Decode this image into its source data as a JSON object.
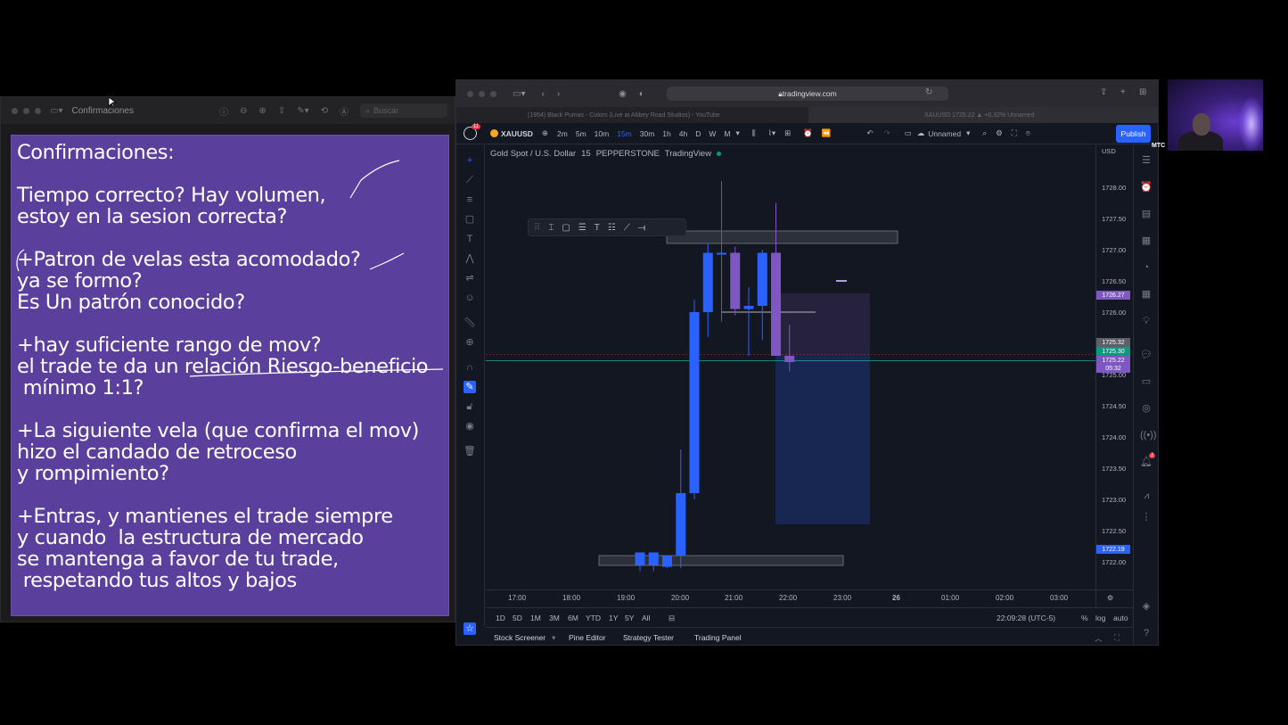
{
  "preview": {
    "title": "Confirmaciones",
    "search_placeholder": "Buscar",
    "slide_lines": [
      "Confirmaciones:",
      "Tiempo correcto? Hay volumen,",
      "estoy en la sesion correcta?",
      "+Patron de velas esta acomodado?",
      "ya se formo?",
      "Es Un patrón conocido?",
      "+hay suficiente rango de mov?",
      "el trade te da un relación Riesgo-beneficio",
      " mínimo 1:1?",
      "+La siguiente vela (que confirma el mov)",
      "hizo el candado de retroceso",
      "y rompimiento?",
      "+Entras, y mantienes el trade siempre",
      "y cuando  la estructura de mercado",
      "se mantenga a favor de tu trade,",
      " respetando tus altos y bajos"
    ]
  },
  "browser": {
    "url": "tradingview.com",
    "tab1": "(1954) Black Pumas - Colors (Live at Abbey Road Studios) - YouTube",
    "tab2": "XAUUSD 1725.22 ▲ +0.32% Unnamed"
  },
  "tv": {
    "notif_count": "11",
    "symbol": "XAUUSD",
    "timeframes": [
      "2m",
      "5m",
      "10m",
      "15m",
      "30m",
      "1h",
      "4h",
      "D",
      "W",
      "M"
    ],
    "active_tf": "15m",
    "layout_name": "Unnamed",
    "publish": "Publish",
    "legend": [
      "Gold Spot / U.S. Dollar",
      "15",
      "PEPPERSTONE",
      "TradingView"
    ],
    "currency": "USD",
    "price_labels": [
      "1728.00",
      "1727.50",
      "1727.00",
      "1726.50",
      "1726.00",
      "1725.00",
      "1724.50",
      "1724.00",
      "1723.50",
      "1723.00",
      "1722.50",
      "1722.00"
    ],
    "tag_purple": "1726.27",
    "tag_gray": "1725.32",
    "tag_green": "1725.30",
    "tag_current": "1725.22",
    "tag_countdown": "05:32",
    "tag_blue": "1722.19",
    "time_labels": [
      "17:00",
      "18:00",
      "19:00",
      "20:00",
      "21:00",
      "22:00",
      "23:00",
      "26",
      "01:00",
      "02:00",
      "03:00"
    ],
    "ranges": [
      "1D",
      "5D",
      "1M",
      "3M",
      "6M",
      "YTD",
      "1Y",
      "5Y",
      "All"
    ],
    "clock": "22:09:28 (UTC-5)",
    "scale_opts": [
      "%",
      "log",
      "auto"
    ],
    "bottom_tabs": [
      "Stock Screener",
      "Pine Editor",
      "Strategy Tester",
      "Trading Panel"
    ],
    "alerts_badge": "2"
  },
  "webcam": {
    "label": "MTC"
  },
  "colors": {
    "candle_up": "#2962ff",
    "candle_down": "#7e57c2",
    "slide_bg": "#5a3f9c",
    "accent": "#2962ff"
  },
  "chart_data": {
    "type": "candlestick",
    "x": [
      "19:15",
      "19:30",
      "19:45",
      "20:00",
      "20:15",
      "20:30",
      "20:45",
      "21:00",
      "21:15",
      "21:30",
      "21:45",
      "22:00"
    ],
    "open": [
      1721.95,
      1721.95,
      1721.92,
      1722.1,
      1723.1,
      1726.0,
      1726.95,
      1726.95,
      1726.05,
      1726.1,
      1726.95,
      1725.3
    ],
    "high": [
      1722.05,
      1722.05,
      1722.0,
      1723.8,
      1726.2,
      1727.1,
      1728.1,
      1727.05,
      1726.4,
      1727.0,
      1727.75,
      1725.8
    ],
    "low": [
      1721.85,
      1721.85,
      1721.9,
      1721.9,
      1723.0,
      1725.6,
      1725.85,
      1725.95,
      1725.3,
      1725.55,
      1725.3,
      1725.05
    ],
    "close": [
      1722.15,
      1722.15,
      1722.1,
      1723.1,
      1726.0,
      1726.95,
      1726.95,
      1726.05,
      1726.1,
      1726.95,
      1725.3,
      1725.2
    ],
    "ylim": [
      1721.8,
      1728.3
    ]
  }
}
